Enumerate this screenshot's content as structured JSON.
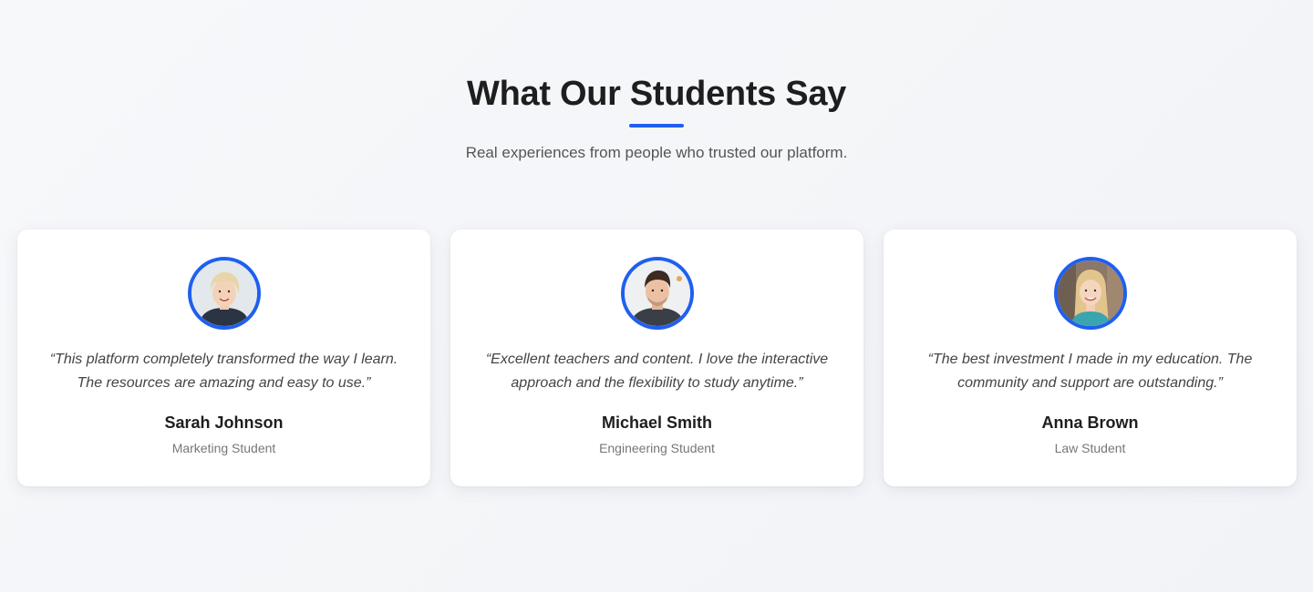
{
  "section": {
    "title": "What Our Students Say",
    "subtitle": "Real experiences from people who trusted our platform.",
    "accent_color": "#1f5ff0"
  },
  "testimonials": [
    {
      "quote": "“This platform completely transformed the way I learn. The resources are amazing and easy to use.”",
      "name": "Sarah Johnson",
      "role": "Marketing Student",
      "avatar_icon": "woman-short-blonde-hair-avatar"
    },
    {
      "quote": "“Excellent teachers and content. I love the interactive approach and the flexibility to study anytime.”",
      "name": "Michael Smith",
      "role": "Engineering Student",
      "avatar_icon": "man-dark-hair-avatar"
    },
    {
      "quote": "“The best investment I made in my education. The community and support are outstanding.”",
      "name": "Anna Brown",
      "role": "Law Student",
      "avatar_icon": "woman-long-blonde-hair-avatar"
    }
  ]
}
